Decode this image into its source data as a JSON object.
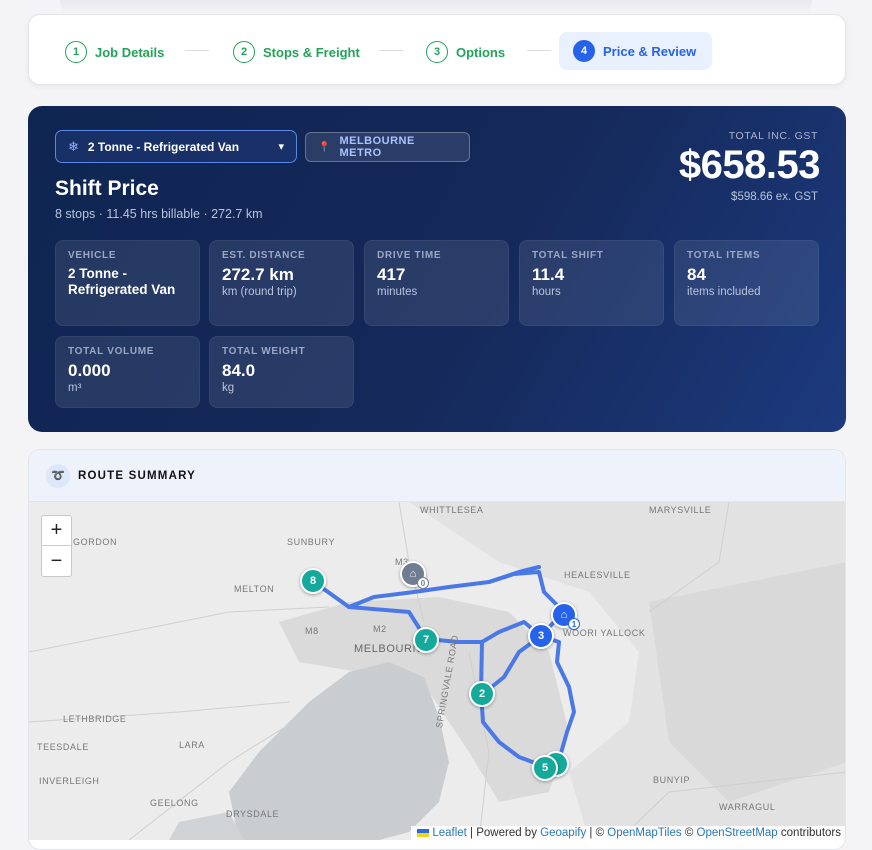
{
  "stepper": {
    "steps": [
      {
        "num": "1",
        "label": "Job Details"
      },
      {
        "num": "2",
        "label": "Stops & Freight"
      },
      {
        "num": "3",
        "label": "Options"
      },
      {
        "num": "4",
        "label": "Price & Review"
      }
    ]
  },
  "price": {
    "vehicle_select": "2 Tonne - Refrigerated Van",
    "region": "MELBOURNE METRO",
    "title": "Shift Price",
    "subtitle": "8 stops · 11.45 hrs billable · 272.7 km",
    "total_label": "TOTAL INC. GST",
    "total": "$658.53",
    "ex_gst": "$598.66 ex. GST",
    "stats": [
      {
        "key": "VEHICLE",
        "value": "2 Tonne - Refrigerated Van",
        "unit": ""
      },
      {
        "key": "EST. DISTANCE",
        "value": "272.7 km",
        "unit": "km (round trip)"
      },
      {
        "key": "DRIVE TIME",
        "value": "417",
        "unit": "minutes"
      },
      {
        "key": "TOTAL SHIFT",
        "value": "11.4",
        "unit": "hours"
      },
      {
        "key": "TOTAL ITEMS",
        "value": "84",
        "unit": "items included"
      },
      {
        "key": "TOTAL VOLUME",
        "value": "0.000",
        "unit": "m³"
      },
      {
        "key": "TOTAL WEIGHT",
        "value": "84.0",
        "unit": "kg"
      }
    ]
  },
  "route": {
    "title": "ROUTE SUMMARY",
    "zoom_in": "+",
    "zoom_out": "−",
    "labels": [
      "WHITTLESEA",
      "MARYSVILLE",
      "GORDON",
      "SUNBURY",
      "HEALESVILLE",
      "MELTON",
      "WOORI YALLOCK",
      "M8",
      "M2",
      "MELBOURNE",
      "M3",
      "LETHBRIDGE",
      "TEESDALE",
      "LARA",
      "INVERLEIGH",
      "GEELONG",
      "DRYSDALE",
      "BUNYIP",
      "WARRAGUL",
      "SPRINGVALE ROAD"
    ],
    "markers": [
      "8",
      "7",
      "3",
      "2",
      "5",
      "0",
      "1"
    ],
    "attribution": {
      "leaflet": "Leaflet",
      "powered": "| Powered by",
      "geoapify": "Geoapify",
      "sep": "| ©",
      "omt": "OpenMapTiles",
      "copy": "©",
      "osm": "OpenStreetMap",
      "contributors": "contributors"
    }
  },
  "colors": {
    "accent": "#2563eb",
    "success": "#22a35a",
    "panel": "#15295a",
    "marker_teal": "#14a99a",
    "route_line": "#4a78e6"
  }
}
